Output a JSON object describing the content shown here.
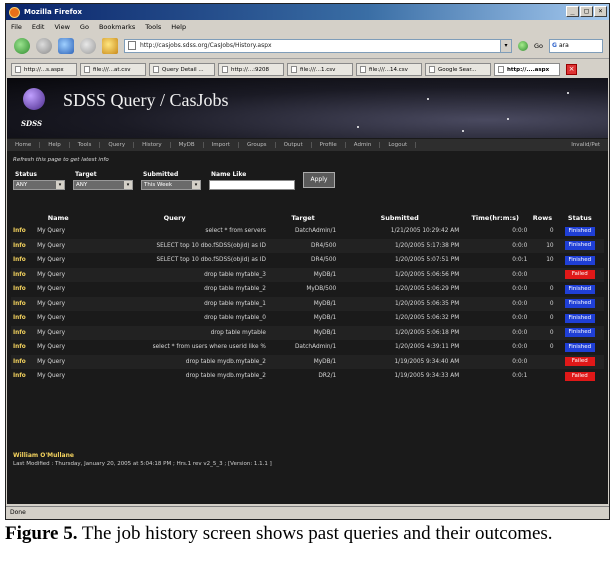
{
  "window": {
    "title": "Mozilla Firefox",
    "controls": [
      "_",
      "□",
      "×"
    ]
  },
  "menu": [
    "File",
    "Edit",
    "View",
    "Go",
    "Bookmarks",
    "Tools",
    "Help"
  ],
  "toolbar": {
    "url": "http://casjobs.sdss.org/CasJobs/History.aspx",
    "go_label": "Go",
    "search_value": "ara"
  },
  "tabs": [
    {
      "label": "http://...s.aspx",
      "active": false
    },
    {
      "label": "file:///...at.csv",
      "active": false
    },
    {
      "label": "Query Detail ...",
      "active": false
    },
    {
      "label": "http://...:9208",
      "active": false
    },
    {
      "label": "file:///...1.csv",
      "active": false
    },
    {
      "label": "file:///...14.csv",
      "active": false
    },
    {
      "label": "Google Sear...",
      "active": false
    },
    {
      "label": "http://....aspx",
      "active": true
    }
  ],
  "banner": {
    "logo_text": "SDSS",
    "title": "SDSS Query / CasJobs"
  },
  "nav": [
    "Home",
    "Help",
    "Tools",
    "Query",
    "History",
    "MyDB",
    "Import",
    "Groups",
    "Output",
    "Profile",
    "Admin",
    "Logout",
    "",
    "",
    "",
    "",
    "",
    "",
    "",
    "",
    "",
    "",
    "",
    "",
    "",
    "",
    "",
    "Invalid/Pet"
  ],
  "refresh_note": "Refresh this page to get latest info",
  "filters": {
    "status_label": "Status",
    "status_value": "ANY",
    "target_label": "Target",
    "target_value": "ANY",
    "submitted_label": "Submitted",
    "submitted_value": "This Week",
    "name_like_label": "Name Like",
    "name_like_value": "",
    "apply_label": "Apply"
  },
  "table": {
    "headers": [
      "",
      "Name",
      "Query",
      "Target",
      "Submitted",
      "Time(hr:m:s)",
      "Rows",
      "Status"
    ],
    "rows": [
      [
        "Info",
        "My Query",
        "select * from servers",
        "DatchAdmin/1",
        "1/21/2005 10:29:42 AM",
        "0:0:0",
        "0",
        "Finished"
      ],
      [
        "Info",
        "My Query",
        "SELECT top 10 dbo.fSDSS(objid) as ID",
        "DR4/500",
        "1/20/2005 5:17:38 PM",
        "0:0:0",
        "10",
        "Finished"
      ],
      [
        "Info",
        "My Query",
        "SELECT top 10 dbo.fSDSS(objid) as ID",
        "DR4/500",
        "1/20/2005 5:07:51 PM",
        "0:0:1",
        "10",
        "Finished"
      ],
      [
        "Info",
        "My Query",
        "drop table mytable_3",
        "MyDB/1",
        "1/20/2005 5:06:56 PM",
        "0:0:0",
        "",
        "Failed"
      ],
      [
        "Info",
        "My Query",
        "drop table mytable_2",
        "MyDB/500",
        "1/20/2005 5:06:29 PM",
        "0:0:0",
        "0",
        "Finished"
      ],
      [
        "Info",
        "My Query",
        "drop table mytable_1",
        "MyDB/1",
        "1/20/2005 5:06:35 PM",
        "0:0:0",
        "0",
        "Finished"
      ],
      [
        "Info",
        "My Query",
        "drop table mytable_0",
        "MyDB/1",
        "1/20/2005 5:06:32 PM",
        "0:0:0",
        "0",
        "Finished"
      ],
      [
        "Info",
        "My Query",
        "drop table mytable",
        "MyDB/1",
        "1/20/2005 5:06:18 PM",
        "0:0:0",
        "0",
        "Finished"
      ],
      [
        "Info",
        "My Query",
        "select * from users where userid like %",
        "DatchAdmin/1",
        "1/20/2005 4:39:11 PM",
        "0:0:0",
        "0",
        "Finished"
      ],
      [
        "Info",
        "My Query",
        "drop table mydb.mytable_2",
        "MyDB/1",
        "1/19/2005 9:34:40 AM",
        "0:0:0",
        "",
        "Failed"
      ],
      [
        "Info",
        "My Query",
        "drop table mydb.mytable_2",
        "DR2/1",
        "1/19/2005 9:34:33 AM",
        "0:0:1",
        "",
        "Failed"
      ]
    ]
  },
  "footer": {
    "name": "William O'Mullane",
    "last_modified": "Last Modified : Thursday, January 20, 2005 at 5:04:18 PM ; Hrs.1 rev v2_5_3 ; [Version: 1.1.1 ]"
  },
  "status_bar": "Done",
  "colors": {
    "finished": "#1f3fd6",
    "failed": "#e01818",
    "info_link": "#f4d35e"
  },
  "caption": {
    "label": "Figure 5.",
    "text": " The job history screen shows past queries and their outcomes."
  }
}
